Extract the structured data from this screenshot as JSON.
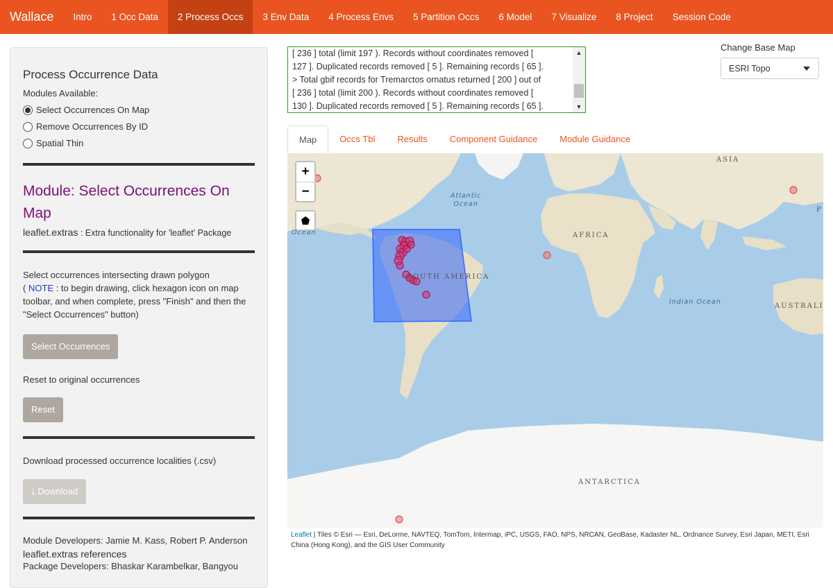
{
  "navbar": {
    "brand": "Wallace",
    "items": [
      "Intro",
      "1 Occ Data",
      "2 Process Occs",
      "3 Env Data",
      "4 Process Envs",
      "5 Partition Occs",
      "6 Model",
      "7 Visualize",
      "8 Project",
      "Session Code"
    ],
    "active_index": 2
  },
  "sidebar": {
    "title": "Process Occurrence Data",
    "modules_label": "Modules Available:",
    "modules": [
      {
        "label": "Select Occurrences On Map",
        "selected": true
      },
      {
        "label": "Remove Occurrences By ID",
        "selected": false
      },
      {
        "label": "Spatial Thin",
        "selected": false
      }
    ],
    "module_title": "Module: Select Occurrences On Map",
    "package": {
      "name": "leaflet.extras",
      "desc": " : Extra functionality for 'leaflet' Package"
    },
    "instruction_part1": "Select occurrences intersecting drawn polygon",
    "instruction_paren_open": "(",
    "instruction_note": "NOTE",
    "instruction_part2": " : to begin drawing, click hexagon icon on map toolbar, and when complete, press \"Finish\" and then the \"Select Occurrences\" button)",
    "select_button": "Select Occurrences",
    "reset_label": "Reset to original occurrences",
    "reset_button": "Reset",
    "download_label": "Download processed occurrence localities (.csv)",
    "download_button": "Download",
    "developers": "Module Developers: Jamie M. Kass, Robert P. Anderson",
    "references_title": "leaflet.extras references",
    "package_developers": "Package Developers: Bhaskar Karambelkar, Bangyou"
  },
  "log": {
    "lines": [
      "[ 236 ] total (limit 197 ). Records without coordinates removed [",
      "127 ]. Duplicated records removed [ 5 ]. Remaining records [ 65 ].",
      "> Total gbif records for Tremarctos ornatus returned [ 200 ] out of",
      "[ 236 ] total (limit 200 ). Records without coordinates removed [",
      "130 ]. Duplicated records removed [ 5 ]. Remaining records [ 65 ]."
    ]
  },
  "basemap": {
    "label": "Change Base Map",
    "selected": "ESRI Topo"
  },
  "tabs": {
    "items": [
      "Map",
      "Occs Tbl",
      "Results",
      "Component Guidance",
      "Module Guidance"
    ],
    "active_index": 0
  },
  "map": {
    "zoom_in": "+",
    "zoom_out": "−",
    "labels": {
      "asia": "ASIA",
      "africa": "AFRICA",
      "south_america": "SOUTH AMERICA",
      "australia": "AUSTRALI",
      "antarctica": "ANTARCTICA",
      "p": "P",
      "atlantic_1": "Atlantic",
      "atlantic_2": "Ocean",
      "indian": "Indian Ocean",
      "ocean_left": "Ocean"
    },
    "colors": {
      "water": "#a9cde8",
      "land": "#ece6d3",
      "ice": "#f6f6f4",
      "polygon": "#3366ff",
      "point": "#d6336c"
    }
  },
  "attribution": {
    "leaflet": "Leaflet",
    "text": " | Tiles © Esri — Esri, DeLorme, NAVTEQ, TomTom, Intermap, iPC, USGS, FAO, NPS, NRCAN, GeoBase, Kadaster NL, Ordnance Survey, Esri Japan, METI, Esri China (Hong Kong), and the GIS User Community"
  }
}
